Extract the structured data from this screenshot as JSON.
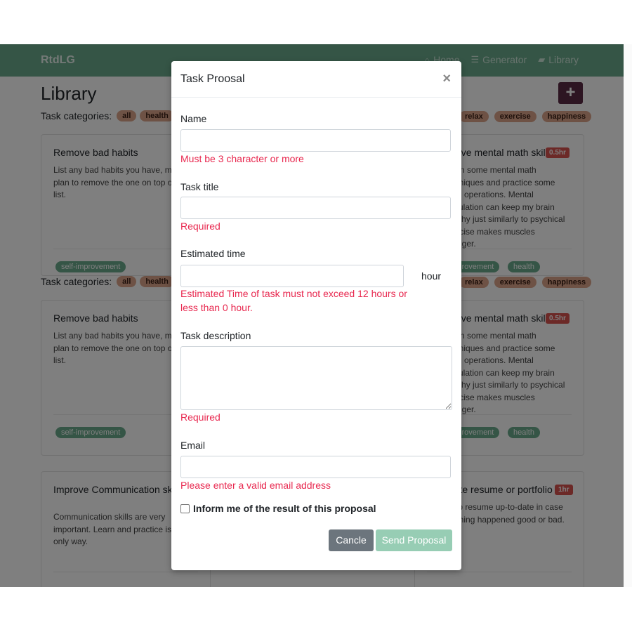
{
  "navbar": {
    "brand": "RtdLG",
    "links": [
      {
        "label": "Home",
        "icon": "home-icon"
      },
      {
        "label": "Generator",
        "icon": "list-icon"
      },
      {
        "label": "Library",
        "icon": "book-icon"
      }
    ]
  },
  "page": {
    "title": "Library",
    "add_label": "+",
    "categories_label": "Task categories:",
    "categories_left": [
      "all",
      "health"
    ],
    "categories_right": [
      "relax",
      "exercise",
      "happiness"
    ]
  },
  "cards": {
    "row1_left": {
      "title": "Remove bad habits",
      "desc": "List any bad habits you have, make a plan to remove the one on top of your list.",
      "tag": "self-improvement"
    },
    "row1_right": {
      "title": "Improve mental math skills",
      "badge": "0.5hr",
      "desc": "Learn some mental math techniques and practice some math operations. Mental stimulation can keep my brain healthy just similarly to psychical exercise makes muscles stronger.",
      "tags": [
        "self-improvement",
        "health"
      ]
    },
    "row2_left": {
      "title": "Remove bad habits",
      "desc": "List any bad habits you have, make a plan to remove the one on top of your list.",
      "tag": "self-improvement"
    },
    "row2_right": {
      "title": "Improve mental math skills",
      "badge": "0.5hr",
      "desc": "Learn some mental math techniques and practice some math operations. Mental stimulation can keep my brain healthy just similarly to psychical exercise makes muscles stronger.",
      "tags": [
        "self-improvement",
        "health"
      ]
    },
    "row3_left": {
      "title": "Improve Communication skills",
      "desc": "Communication skills are very important. Learn and practice is the only way."
    },
    "row3_right": {
      "title": "Update resume or portfolio",
      "badge": "1hr",
      "desc": "Keep resume up-to-date in case anything happened good or bad."
    }
  },
  "modal": {
    "title": "Task Proosal",
    "close": "×",
    "name_label": "Name",
    "name_error": "Must be 3 character or more",
    "title_label": "Task title",
    "title_error": "Required",
    "time_label": "Estimated time",
    "time_unit": "hour",
    "time_error_1": "Estimated Time of task must not exceed 12 hours or",
    "time_error_2": "less than 0 hour.",
    "desc_label": "Task description",
    "desc_error": "Required",
    "email_label": "Email",
    "email_error": "Please enter a valid email address",
    "inform_label": "Inform me of the result of this proposal",
    "cancel": "Cancle",
    "send": "Send Proposal"
  },
  "colors": {
    "navbar": "#6aaa8c",
    "add_button": "#5b2a44",
    "error": "#e8284f",
    "send_button": "#97cdb4",
    "cancel_button": "#6c757d"
  }
}
